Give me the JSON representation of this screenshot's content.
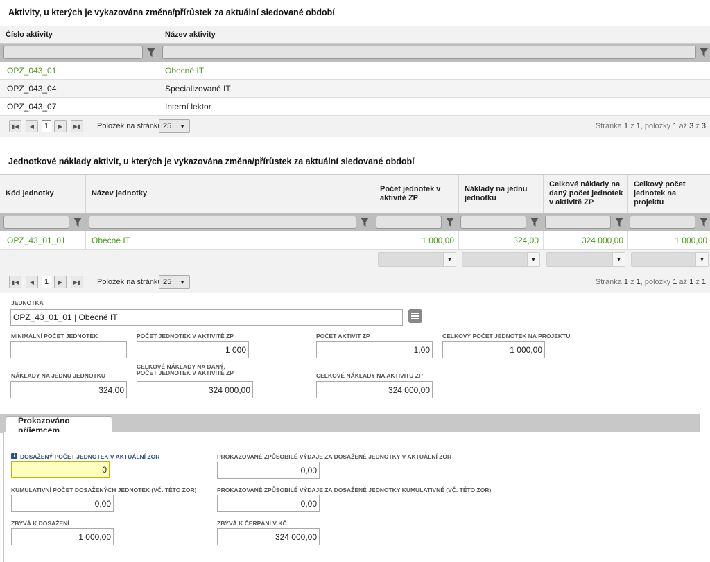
{
  "activities": {
    "title": "Aktivity, u kterých je vykazována změna/přírůstek za aktuální sledované období",
    "columns": [
      "Číslo aktivity",
      "Název aktivity"
    ],
    "rows": [
      {
        "code": "OPZ_043_01",
        "name": "Obecné IT",
        "selected": true
      },
      {
        "code": "OPZ_043_04",
        "name": "Specializované IT",
        "selected": false
      },
      {
        "code": "OPZ_043_07",
        "name": "Interní lektor",
        "selected": false
      }
    ],
    "pager": {
      "current_page": "1",
      "per_page_label": "Položek na stránku",
      "per_page": "25",
      "info_prefix": "Stránka",
      "info_page": "1",
      "info_of": "z",
      "info_total_pages": "1",
      "info_items": ", položky",
      "info_from": "1",
      "info_to_label": "až",
      "info_to": "3",
      "info_of2": "z",
      "info_total": "3"
    }
  },
  "units": {
    "title": "Jednotkové náklady aktivit, u kterých je vykazována změna/přírůstek za aktuální sledované období",
    "columns": [
      "Kód jednotky",
      "Název jednotky",
      "Počet jednotek v aktivitě ZP",
      "Náklady na jednu jednotku",
      "Celkové náklady na daný počet jednotek v aktivitě ZP",
      "Celkový počet jednotek na projektu"
    ],
    "rows": [
      {
        "code": "OPZ_43_01_01",
        "name": "Obecné IT",
        "count": "1 000,00",
        "unit_cost": "324,00",
        "total_cost": "324 000,00",
        "project_total": "1 000,00"
      }
    ],
    "pager": {
      "current_page": "1",
      "per_page_label": "Položek na stránku",
      "per_page": "25",
      "info_prefix": "Stránka",
      "info_page": "1",
      "info_of": "z",
      "info_total_pages": "1",
      "info_items": ", položky",
      "info_from": "1",
      "info_to_label": "až",
      "info_to": "1",
      "info_of2": "z",
      "info_total": "1"
    }
  },
  "detail": {
    "unit_label": "Jednotka",
    "unit_value": "OPZ_43_01_01 | Obecné IT",
    "min_count_label": "Minimální počet jednotek",
    "min_count_value": "",
    "count_in_activity_label": "Počet jednotek v aktivitě ZP",
    "count_in_activity_value": "1 000",
    "activity_count_label": "Počet aktivit ZP",
    "activity_count_value": "1,00",
    "project_total_label": "Celkový počet jednotek na projektu",
    "project_total_value": "1 000,00",
    "unit_cost_label": "Náklady na jednu jednotku",
    "unit_cost_value": "324,00",
    "total_cost_label_1": "Celkové náklady na daný,",
    "total_cost_label_2": "počet jednotek v aktivitě ZP",
    "total_cost_value": "324 000,00",
    "activity_cost_label": "Celkové náklady na aktivitu ZP",
    "activity_cost_value": "324 000,00"
  },
  "tab": {
    "label": "Prokazováno příjemcem",
    "achieved_label": "Dosažený počet jednotek v aktuální ZOR",
    "achieved_value": "0",
    "proven_label": "Prokazované způsobilé výdaje za dosažené jednotky v aktuální ZOR",
    "proven_value": "0,00",
    "cumulative_label": "Kumulativní počet dosažených jednotek (vč. této ZOR)",
    "cumulative_value": "0,00",
    "proven_cum_label": "Prokazované způsobilé výdaje za dosažené jednotky kumulativně (vč. této ZOR)",
    "proven_cum_value": "0,00",
    "remaining_label": "Zbývá k dosažení",
    "remaining_value": "1 000,00",
    "remaining_draw_label": "Zbývá k čerpání v Kč",
    "remaining_draw_value": "324 000,00"
  },
  "colors": {
    "accent_green": "#4c9a1a",
    "required_yellow": "#ffffc0"
  }
}
